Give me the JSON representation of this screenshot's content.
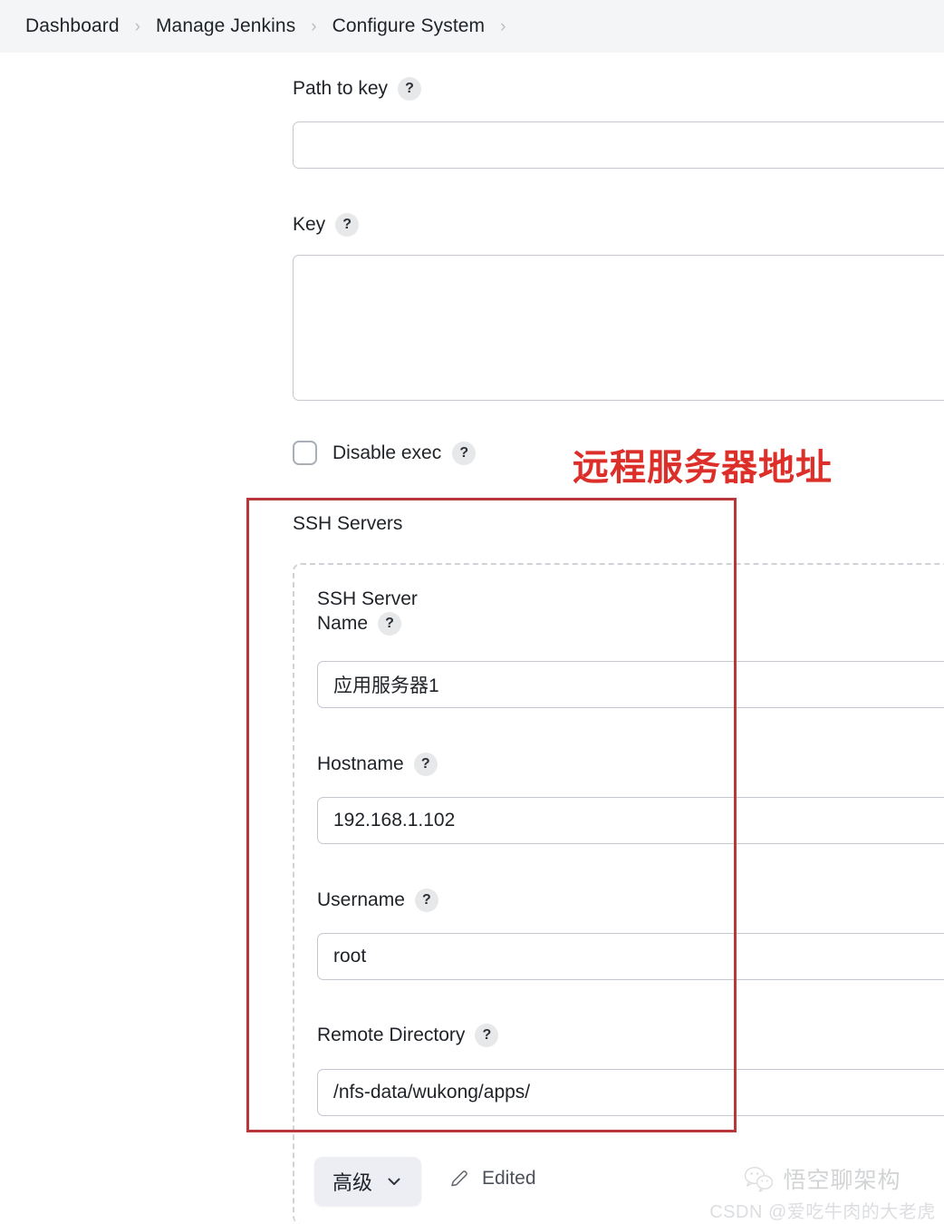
{
  "breadcrumb": {
    "items": [
      {
        "label": "Dashboard"
      },
      {
        "label": "Manage Jenkins"
      },
      {
        "label": "Configure System"
      }
    ],
    "separator": "›"
  },
  "help_glyph": "?",
  "form": {
    "path_to_key": {
      "label": "Path to key",
      "value": "",
      "placeholder": ""
    },
    "key": {
      "label": "Key",
      "value": "",
      "placeholder": ""
    },
    "disable_exec": {
      "label": "Disable exec",
      "checked": false
    }
  },
  "ssh_servers": {
    "title": "SSH Servers",
    "server": {
      "name_label_line1": "SSH Server",
      "name_label_line2": "Name",
      "name_value": "应用服务器1",
      "hostname_label": "Hostname",
      "hostname_value": "192.168.1.102",
      "username_label": "Username",
      "username_value": "root",
      "remote_directory_label": "Remote Directory",
      "remote_directory_value": "/nfs-data/wukong/apps/"
    },
    "advanced_button_label": "高级",
    "edited_label": "Edited"
  },
  "annotation": {
    "text": "远程服务器地址",
    "color": "#dd2f2a",
    "box_color": "#b8373a"
  },
  "watermark": {
    "account_name": "悟空聊架构",
    "credit": "CSDN @爱吃牛肉的大老虎"
  },
  "colors": {
    "page_background": "#ffffff",
    "breadcrumb_background": "#f4f5f7",
    "input_border": "#c3c8ce",
    "dashed_border": "#cfd3d8",
    "help_icon_background": "#e7e8ea",
    "advanced_button_background": "#eceef4",
    "text": "#1f2328"
  }
}
